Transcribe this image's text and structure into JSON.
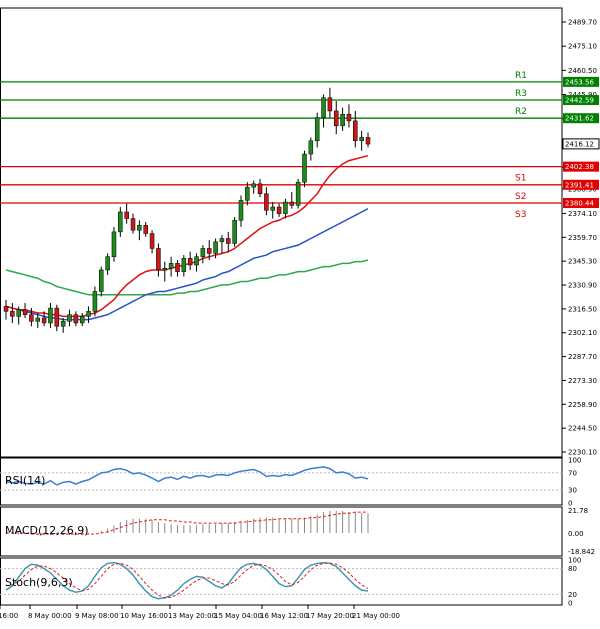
{
  "chart_data": {
    "type": "candlestick",
    "y_axis_ticks": [
      "2489.70",
      "2475.10",
      "2460.50",
      "2445.90",
      "2431.30",
      "2416.70",
      "2402.10",
      "2388.90",
      "2374.10",
      "2359.70",
      "2345.30",
      "2330.90",
      "2316.50",
      "2302.10",
      "2287.70",
      "2273.30",
      "2258.90",
      "2244.50",
      "2230.10"
    ],
    "x_axis_ticks": [
      "16:00",
      "8 May 00:00",
      "9 May 08:00",
      "10 May 16:00",
      "13 May 20:00",
      "15 May 04:00",
      "16 May 12:00",
      "17 May 20:00",
      "21 May 00:00"
    ],
    "ylim": [
      2230.1,
      2489.7
    ],
    "last_price": "2416.12",
    "levels": [
      {
        "name": "R3",
        "value": 2442.59,
        "label": "2442.59",
        "color": "#008000"
      },
      {
        "name": "R2",
        "value": 2431.62,
        "label": "2431.62",
        "color": "#008000"
      },
      {
        "name": "R1",
        "value": 2453.56,
        "label": "2453.56",
        "color": "#008000"
      },
      {
        "name": "S1",
        "value": 2402.38,
        "label": "2402.38",
        "color": "#e00000"
      },
      {
        "name": "S2",
        "value": 2391.41,
        "label": "2391.41",
        "color": "#e00000"
      },
      {
        "name": "S3",
        "value": 2380.44,
        "label": "2380.44",
        "color": "#e00000"
      }
    ],
    "candles": [
      [
        2318,
        2322,
        2310,
        2315
      ],
      [
        2315,
        2320,
        2308,
        2312
      ],
      [
        2312,
        2318,
        2307,
        2316
      ],
      [
        2316,
        2320,
        2311,
        2313
      ],
      [
        2313,
        2317,
        2306,
        2309
      ],
      [
        2309,
        2314,
        2305,
        2311
      ],
      [
        2311,
        2315,
        2306,
        2308
      ],
      [
        2308,
        2320,
        2305,
        2317
      ],
      [
        2317,
        2319,
        2303,
        2306
      ],
      [
        2306,
        2311,
        2302,
        2309
      ],
      [
        2309,
        2316,
        2306,
        2313
      ],
      [
        2313,
        2315,
        2306,
        2308
      ],
      [
        2308,
        2314,
        2306,
        2312
      ],
      [
        2312,
        2318,
        2308,
        2315
      ],
      [
        2315,
        2330,
        2312,
        2327
      ],
      [
        2327,
        2342,
        2324,
        2340
      ],
      [
        2340,
        2350,
        2337,
        2348
      ],
      [
        2348,
        2366,
        2345,
        2363
      ],
      [
        2363,
        2378,
        2360,
        2375
      ],
      [
        2375,
        2380,
        2368,
        2371
      ],
      [
        2371,
        2374,
        2362,
        2364
      ],
      [
        2364,
        2370,
        2358,
        2367
      ],
      [
        2367,
        2369,
        2360,
        2362
      ],
      [
        2362,
        2364,
        2350,
        2353
      ],
      [
        2353,
        2356,
        2336,
        2340
      ],
      [
        2340,
        2345,
        2333,
        2341
      ],
      [
        2341,
        2348,
        2336,
        2344
      ],
      [
        2344,
        2346,
        2336,
        2339
      ],
      [
        2339,
        2349,
        2336,
        2347
      ],
      [
        2347,
        2351,
        2340,
        2343
      ],
      [
        2343,
        2350,
        2339,
        2348
      ],
      [
        2348,
        2355,
        2344,
        2353
      ],
      [
        2353,
        2358,
        2346,
        2350
      ],
      [
        2350,
        2359,
        2347,
        2357
      ],
      [
        2357,
        2361,
        2350,
        2359
      ],
      [
        2359,
        2363,
        2351,
        2356
      ],
      [
        2356,
        2372,
        2354,
        2370
      ],
      [
        2370,
        2385,
        2366,
        2382
      ],
      [
        2382,
        2393,
        2379,
        2390
      ],
      [
        2390,
        2394,
        2386,
        2392
      ],
      [
        2392,
        2395,
        2384,
        2386
      ],
      [
        2386,
        2390,
        2373,
        2376
      ],
      [
        2376,
        2381,
        2371,
        2378
      ],
      [
        2378,
        2380,
        2372,
        2374
      ],
      [
        2374,
        2383,
        2371,
        2381
      ],
      [
        2381,
        2387,
        2377,
        2379
      ],
      [
        2379,
        2395,
        2377,
        2393
      ],
      [
        2393,
        2412,
        2390,
        2410
      ],
      [
        2410,
        2420,
        2406,
        2418
      ],
      [
        2418,
        2435,
        2414,
        2432
      ],
      [
        2432,
        2446,
        2426,
        2444
      ],
      [
        2444,
        2450,
        2432,
        2436
      ],
      [
        2436,
        2442,
        2422,
        2427
      ],
      [
        2427,
        2438,
        2424,
        2434
      ],
      [
        2434,
        2440,
        2426,
        2430
      ],
      [
        2430,
        2436,
        2414,
        2418
      ],
      [
        2418,
        2424,
        2412,
        2420
      ],
      [
        2420,
        2423,
        2414,
        2416
      ]
    ],
    "ma_red": [
      2318,
      2317,
      2316,
      2316,
      2315,
      2314,
      2314,
      2313,
      2313,
      2312,
      2312,
      2312,
      2312,
      2313,
      2314,
      2316,
      2319,
      2322,
      2327,
      2331,
      2334,
      2337,
      2339,
      2340,
      2340,
      2340,
      2341,
      2342,
      2343,
      2344,
      2345,
      2347,
      2348,
      2349,
      2350,
      2351,
      2353,
      2356,
      2359,
      2362,
      2365,
      2367,
      2369,
      2370,
      2372,
      2373,
      2375,
      2378,
      2382,
      2386,
      2392,
      2397,
      2401,
      2404,
      2406,
      2407,
      2408,
      2409
    ],
    "ma_blue": [
      2318,
      2317,
      2316,
      2315,
      2314,
      2313,
      2312,
      2311,
      2311,
      2310,
      2310,
      2310,
      2310,
      2310,
      2311,
      2312,
      2313,
      2315,
      2317,
      2319,
      2321,
      2323,
      2325,
      2326,
      2327,
      2327,
      2328,
      2329,
      2330,
      2331,
      2332,
      2334,
      2335,
      2336,
      2338,
      2339,
      2341,
      2343,
      2345,
      2347,
      2348,
      2349,
      2351,
      2352,
      2353,
      2354,
      2355,
      2357,
      2359,
      2361,
      2363,
      2365,
      2367,
      2369,
      2371,
      2373,
      2375,
      2377
    ],
    "ma_green": [
      2340,
      2339,
      2338,
      2337,
      2336,
      2335,
      2333,
      2332,
      2330,
      2329,
      2328,
      2327,
      2326,
      2325,
      2325,
      2325,
      2325,
      2325,
      2325,
      2325,
      2325,
      2325,
      2325,
      2325,
      2325,
      2325,
      2325,
      2326,
      2326,
      2327,
      2327,
      2328,
      2329,
      2330,
      2331,
      2331,
      2332,
      2333,
      2333,
      2334,
      2335,
      2335,
      2336,
      2337,
      2337,
      2338,
      2339,
      2339,
      2340,
      2341,
      2342,
      2342,
      2343,
      2344,
      2344,
      2345,
      2345,
      2346
    ],
    "rsi": {
      "label": "RSI(14)",
      "ticks": [
        "100",
        "70",
        "30",
        "0"
      ],
      "values": [
        50,
        47,
        50,
        46,
        44,
        48,
        44,
        52,
        42,
        48,
        50,
        44,
        50,
        54,
        62,
        70,
        72,
        78,
        80,
        76,
        68,
        70,
        65,
        58,
        50,
        58,
        60,
        55,
        62,
        58,
        63,
        64,
        60,
        65,
        66,
        64,
        70,
        74,
        76,
        78,
        72,
        62,
        64,
        62,
        66,
        64,
        70,
        76,
        80,
        82,
        84,
        80,
        70,
        72,
        68,
        58,
        60,
        56
      ]
    },
    "macd": {
      "label": "MACD(12,26,9)",
      "ticks": [
        "21.78",
        "0.00",
        "-18.842"
      ],
      "histogram": [
        0,
        0,
        -1,
        -1,
        -1,
        -2,
        -2,
        -2,
        -2,
        -2,
        -2,
        -2,
        -2,
        -1,
        0,
        2,
        4,
        7,
        10,
        12,
        13,
        13,
        13,
        12,
        10,
        9,
        8,
        7,
        7,
        7,
        7,
        8,
        8,
        8,
        9,
        9,
        10,
        11,
        12,
        13,
        14,
        14,
        14,
        13,
        13,
        13,
        13,
        14,
        15,
        17,
        19,
        20,
        20,
        20,
        19,
        19,
        18,
        18
      ],
      "signal": [
        0,
        0,
        0,
        0,
        -1,
        -1,
        -1,
        -1,
        -1,
        -1,
        -1,
        -1,
        -1,
        -1,
        -1,
        0,
        1,
        3,
        5,
        7,
        9,
        10,
        11,
        12,
        12,
        12,
        11,
        11,
        10,
        10,
        9,
        9,
        9,
        9,
        9,
        9,
        9,
        10,
        10,
        11,
        11,
        12,
        12,
        13,
        13,
        13,
        13,
        13,
        14,
        14,
        15,
        16,
        17,
        18,
        18,
        19,
        19,
        19
      ]
    },
    "stoch": {
      "label": "Stoch(9,6,3)",
      "ticks": [
        "100",
        "80",
        "20",
        "0"
      ],
      "k": [
        30,
        40,
        60,
        80,
        90,
        88,
        80,
        70,
        55,
        40,
        30,
        25,
        28,
        40,
        62,
        82,
        92,
        94,
        90,
        80,
        65,
        45,
        28,
        15,
        10,
        12,
        18,
        30,
        45,
        55,
        62,
        60,
        50,
        40,
        35,
        45,
        65,
        82,
        90,
        92,
        88,
        78,
        62,
        45,
        38,
        40,
        58,
        78,
        88,
        92,
        94,
        92,
        85,
        70,
        55,
        40,
        30,
        28
      ],
      "d": [
        40,
        42,
        50,
        65,
        78,
        86,
        86,
        80,
        70,
        58,
        45,
        35,
        28,
        32,
        45,
        62,
        80,
        90,
        92,
        88,
        78,
        62,
        45,
        30,
        18,
        12,
        13,
        20,
        30,
        42,
        52,
        58,
        58,
        52,
        45,
        42,
        50,
        65,
        78,
        88,
        90,
        86,
        78,
        65,
        50,
        42,
        48,
        62,
        78,
        88,
        92,
        93,
        90,
        82,
        70,
        55,
        42,
        34
      ]
    }
  }
}
